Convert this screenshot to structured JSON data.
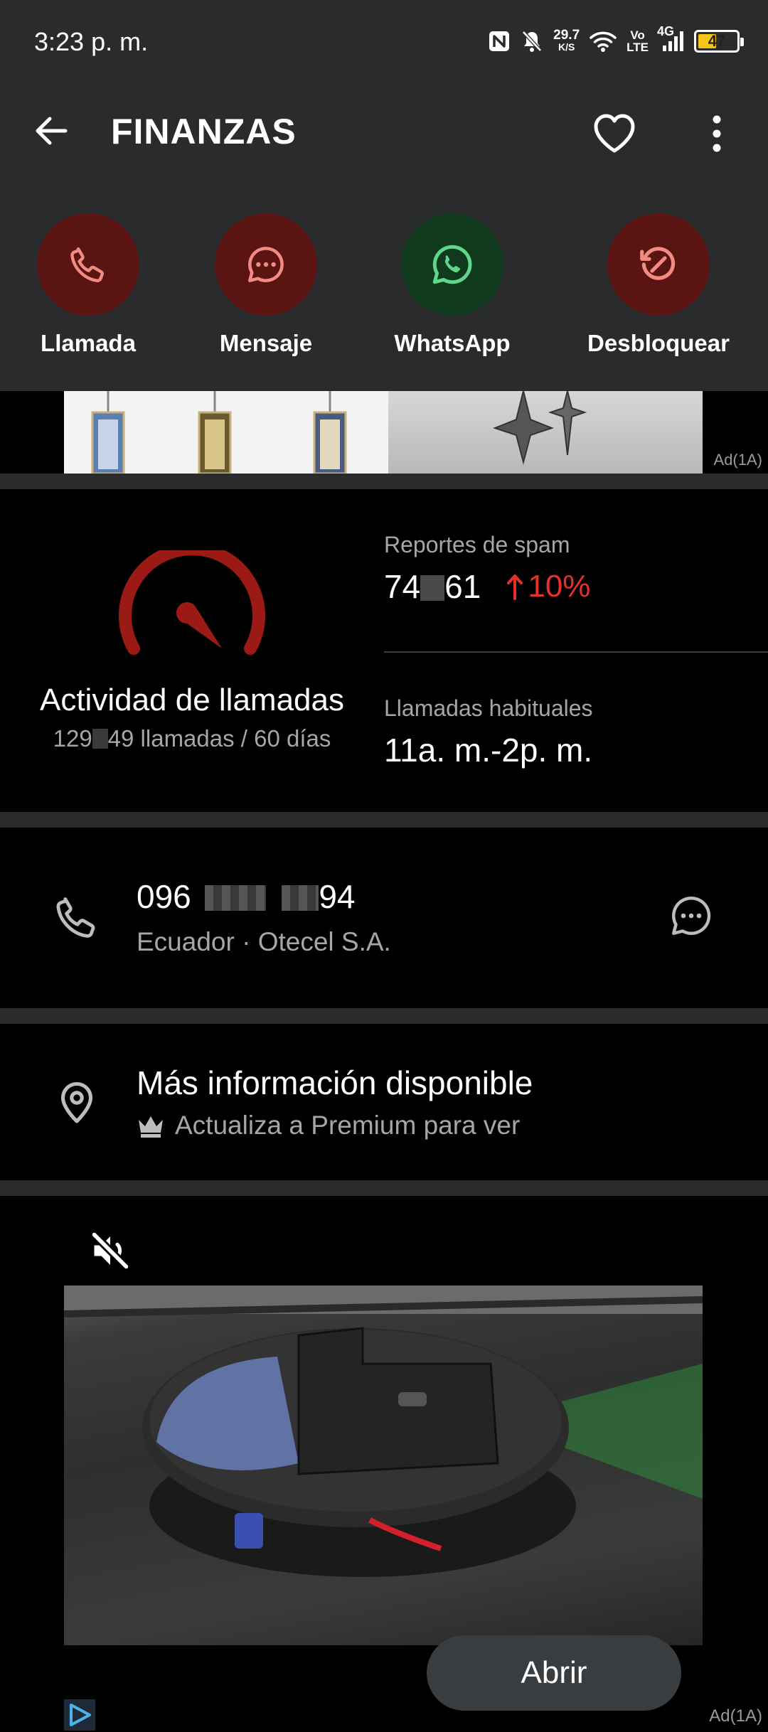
{
  "status_bar": {
    "time": "3:23 p. m.",
    "net_speed_value": "29.7",
    "net_speed_unit": "K/S",
    "volte_top": "Vo",
    "volte_bottom": "LTE",
    "network": "4G",
    "battery": "47",
    "icons": [
      "nfc-icon",
      "bell-off-icon",
      "wifi-icon",
      "signal-icon",
      "battery-icon"
    ]
  },
  "header": {
    "title": "FINANZAS",
    "icons": [
      "back-arrow-icon",
      "heart-icon",
      "more-vert-icon"
    ]
  },
  "actions": [
    {
      "label": "Llamada",
      "icon": "phone-icon",
      "color": "#5a1412",
      "icon_color": "#f28b82"
    },
    {
      "label": "Mensaje",
      "icon": "chat-bubble-icon",
      "color": "#5a1412",
      "icon_color": "#f28b82"
    },
    {
      "label": "WhatsApp",
      "icon": "whatsapp-icon",
      "color": "#0f3a1e",
      "icon_color": "#5fd68a"
    },
    {
      "label": "Desbloquear",
      "icon": "unblock-icon",
      "color": "#5a1412",
      "icon_color": "#f28b82"
    }
  ],
  "ad_banner": {
    "tag": "Ad(1A)"
  },
  "stats": {
    "activity_title": "Actividad de llamadas",
    "activity_sub_prefix": "129",
    "activity_sub_suffix": "49 llamadas / 60 días",
    "spam_label": "Reportes de spam",
    "spam_prefix": "74",
    "spam_suffix": "61",
    "spam_trend": "10%",
    "habitual_label": "Llamadas habituales",
    "habitual_value": "11a. m.-2p. m.",
    "accent": "#e8302a",
    "gauge_color": "#9c1a16"
  },
  "number": {
    "prefix": "096",
    "suffix": "94",
    "subtitle": "Ecuador · Otecel S.A."
  },
  "more_info": {
    "title": "Más información disponible",
    "subtitle": "Actualiza a Premium para ver"
  },
  "video_ad": {
    "button": "Abrir",
    "tag": "Ad(1A)"
  }
}
